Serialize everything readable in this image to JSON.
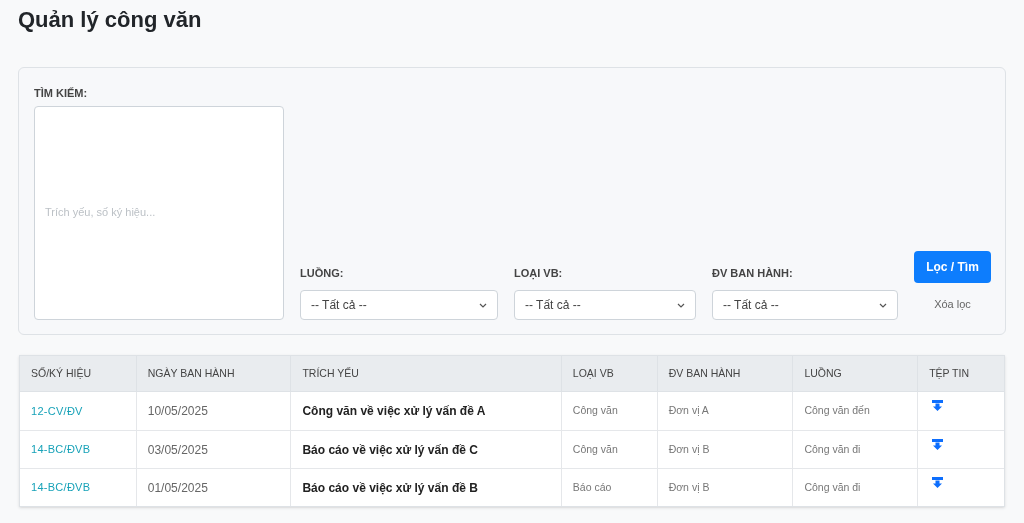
{
  "title": "Quản lý công văn",
  "filter": {
    "search_label": "TÌM KIẾM:",
    "search_placeholder": "Trích yếu, số ký hiệu...",
    "selects": [
      {
        "label": "LUỒNG:",
        "value": "-- Tất cả --"
      },
      {
        "label": "LOẠI VB:",
        "value": "-- Tất cả --"
      },
      {
        "label": "ĐV BAN HÀNH:",
        "value": "-- Tất cả --"
      }
    ],
    "submit": "Lọc / Tìm",
    "clear": "Xóa lọc"
  },
  "table": {
    "columns": [
      "SỐ/KÝ HIỆU",
      "NGÀY BAN HÀNH",
      "TRÍCH YẾU",
      "LOẠI VB",
      "ĐV BAN HÀNH",
      "LUỒNG",
      "TỆP TIN"
    ],
    "rows": [
      {
        "number": "12-CV/ĐV",
        "date": "10/05/2025",
        "summary": "Công văn về việc xử lý vấn đề A",
        "type": "Công văn",
        "unit": "Đơn vị A",
        "flow": "Công văn đến"
      },
      {
        "number": "14-BC/ĐVB",
        "date": "03/05/2025",
        "summary": "Báo cáo về việc xử lý vấn đề C",
        "type": "Công văn",
        "unit": "Đơn vị B",
        "flow": "Công văn đi"
      },
      {
        "number": "14-BC/ĐVB",
        "date": "01/05/2025",
        "summary": "Báo cáo về việc xử lý vấn đề B",
        "type": "Báo cáo",
        "unit": "Đơn vị B",
        "flow": "Công văn đi"
      }
    ]
  }
}
